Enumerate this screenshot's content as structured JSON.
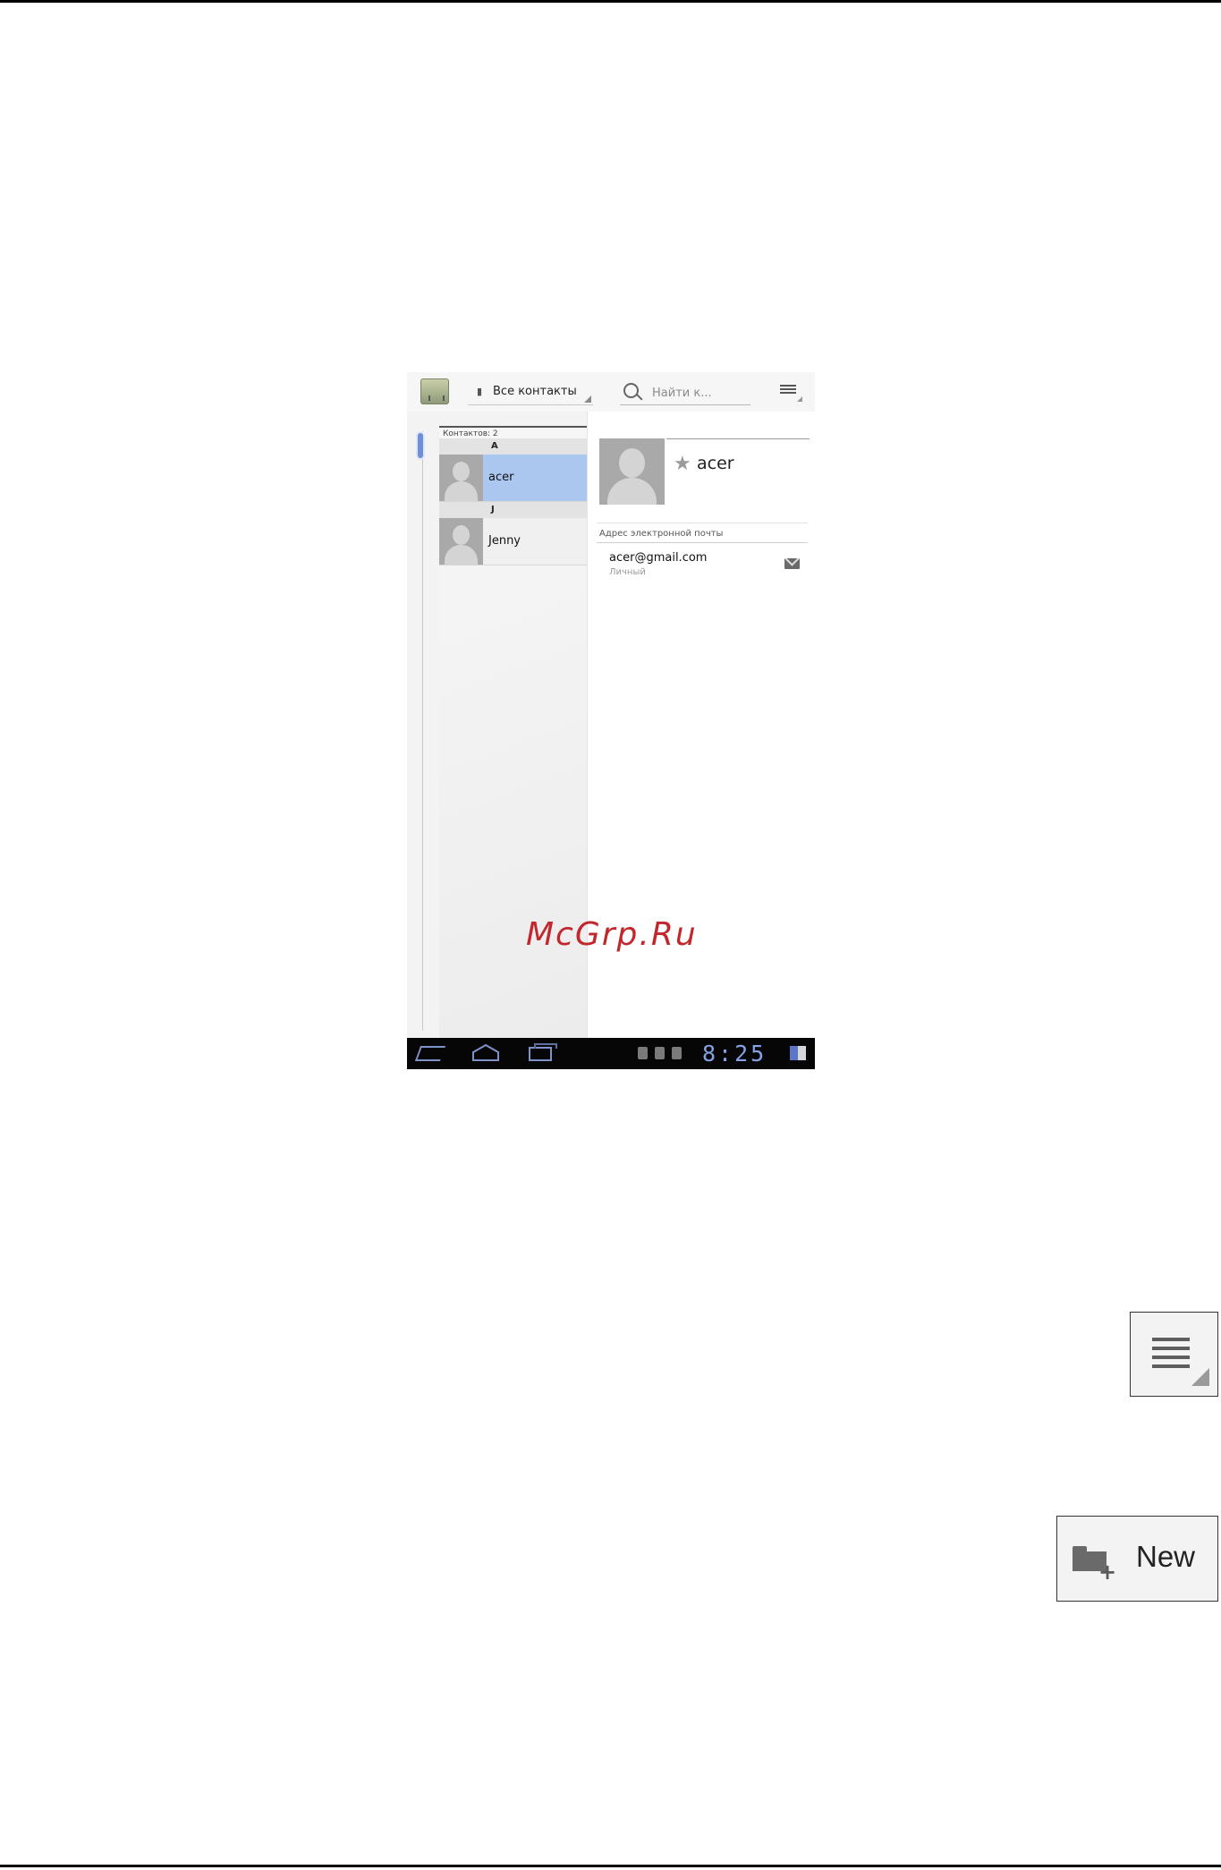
{
  "actionbar": {
    "filter_label": "Все контакты",
    "search_placeholder": "Найти к..."
  },
  "list": {
    "count_label": "Контактов: 2",
    "sections": [
      {
        "letter": "A",
        "contacts": [
          {
            "name": "acer",
            "selected": true
          }
        ]
      },
      {
        "letter": "J",
        "contacts": [
          {
            "name": "Jenny",
            "selected": false
          }
        ]
      }
    ]
  },
  "detail": {
    "name": "acer",
    "starred": false,
    "email_header": "Адрес электронной почты",
    "email_value": "acer@gmail.com",
    "email_type": "Личный"
  },
  "watermark": "McGrp.Ru",
  "statusbar": {
    "clock": "8:25"
  },
  "icons": {
    "menu": "menu-overflow-icon",
    "new_label": "New"
  },
  "colors": {
    "selection": "#abc7f0",
    "watermark": "#c2272d",
    "clock": "#86a1e6"
  }
}
